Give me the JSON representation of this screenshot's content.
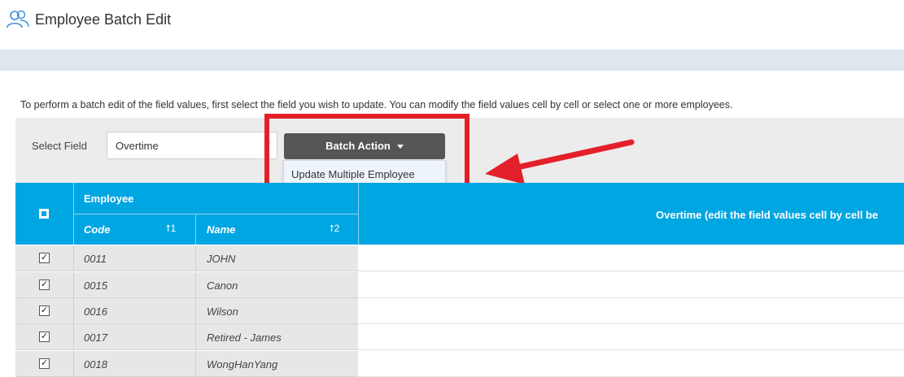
{
  "header": {
    "title": "Employee Batch Edit",
    "icon": "users-icon"
  },
  "instructions": "To perform a batch edit of the field values, first select the field you wish to update. You can modify the field values cell by cell or select one or more employees.",
  "toolbar": {
    "select_label": "Select Field",
    "select_value": "Overtime",
    "batch_button_label": "Batch Action",
    "dropdown_item": "Update Multiple Employee"
  },
  "table": {
    "group_header": "Employee",
    "code_header": "Code",
    "code_sort": "⭡1",
    "name_header": "Name",
    "name_sort": "⭡2",
    "value_header": "Overtime (edit the field values cell by cell be",
    "rows": [
      {
        "code": "0011",
        "name": "JOHN",
        "checked": true
      },
      {
        "code": "0015",
        "name": "Canon",
        "checked": true
      },
      {
        "code": "0016",
        "name": "Wilson",
        "checked": true
      },
      {
        "code": "0017",
        "name": "Retired - James",
        "checked": true
      },
      {
        "code": "0018",
        "name": "WongHanYang",
        "checked": true
      }
    ]
  },
  "colors": {
    "accent": "#00a6e2",
    "highlight": "#e3202a",
    "button": "#555555"
  }
}
